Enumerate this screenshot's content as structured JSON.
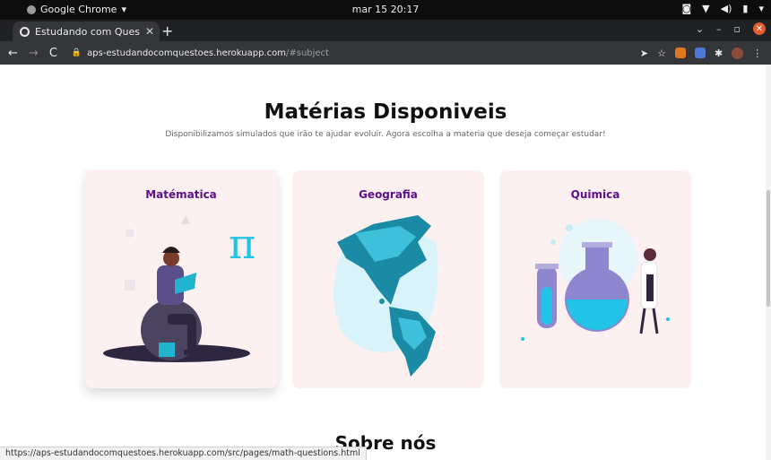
{
  "os": {
    "app_name": "Google Chrome",
    "clock": "mar 15  20:17"
  },
  "browser": {
    "tab_title": "Estudando com Questões",
    "url_host": "aps-estudandocomquestoes.herokuapp.com",
    "url_path": "/#subject",
    "status_url": "https://aps-estudandocomquestoes.herokuapp.com/src/pages/math-questions.html"
  },
  "page": {
    "heading": "Matérias Disponiveis",
    "subtitle": "Disponibilizamos simulados que irão te ajudar evoluir. Agora escolha a materia que deseja começar estudar!",
    "subjects": [
      {
        "label": "Matématica",
        "icon": "math-illustration"
      },
      {
        "label": "Geografia",
        "icon": "geography-illustration"
      },
      {
        "label": "Quimica",
        "icon": "chemistry-illustration"
      }
    ],
    "about_heading": "Sobre nós",
    "math_symbol": "π"
  },
  "colors": {
    "accent": "#5c0f8b",
    "card_bg": "#fdf0f0",
    "teal": "#21b4cf"
  }
}
